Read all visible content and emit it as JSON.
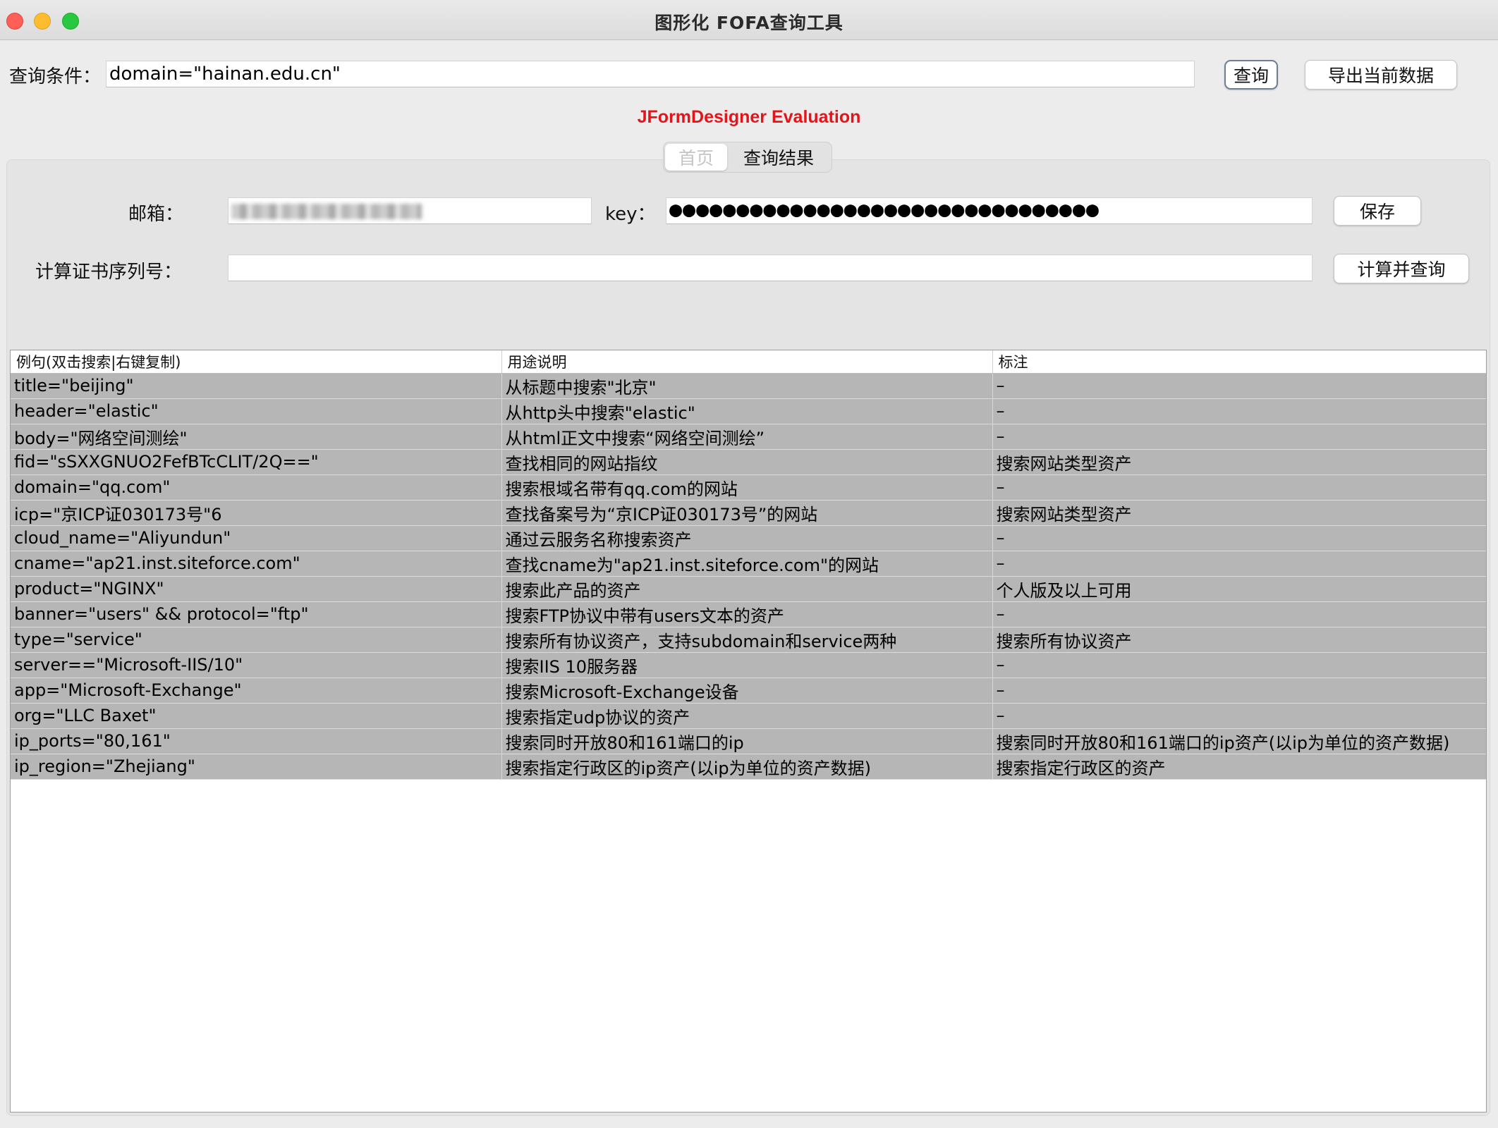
{
  "window": {
    "title": "图形化 FOFA查询工具"
  },
  "query": {
    "label": "查询条件：",
    "value": "domain=\"hainan.edu.cn\"",
    "query_button": "查询",
    "export_button": "导出当前数据"
  },
  "eval_banner": "JFormDesigner Evaluation",
  "tabs": {
    "home": "首页",
    "results": "查询结果"
  },
  "form": {
    "email_label": "邮箱：",
    "key_label": "key：",
    "key_value": "●●●●●●●●●●●●●●●●●●●●●●●●●●●●●●●●",
    "save_button": "保存",
    "serial_label": "计算证书序列号：",
    "serial_value": "",
    "calc_button": "计算并查询"
  },
  "table": {
    "headers": [
      "例句(双击搜索|右键复制)",
      "用途说明",
      "标注"
    ],
    "rows": [
      [
        "title=\"beijing\"",
        "从标题中搜索\"北京\"",
        "–"
      ],
      [
        "header=\"elastic\"",
        "从http头中搜索\"elastic\"",
        "–"
      ],
      [
        "body=\"网络空间测绘\"",
        "从html正文中搜索“网络空间测绘”",
        "–"
      ],
      [
        "fid=\"sSXXGNUO2FefBTcCLIT/2Q==\"",
        "查找相同的网站指纹",
        "搜索网站类型资产"
      ],
      [
        "domain=\"qq.com\"",
        "搜索根域名带有qq.com的网站",
        "–"
      ],
      [
        "icp=\"京ICP证030173号\"6",
        "查找备案号为“京ICP证030173号”的网站",
        "搜索网站类型资产"
      ],
      [
        "cloud_name=\"Aliyundun\"",
        "通过云服务名称搜索资产",
        "–"
      ],
      [
        "cname=\"ap21.inst.siteforce.com\"",
        "查找cname为\"ap21.inst.siteforce.com\"的网站",
        "–"
      ],
      [
        "product=\"NGINX\"",
        "搜索此产品的资产",
        "个人版及以上可用"
      ],
      [
        "banner=\"users\" && protocol=\"ftp\"",
        "搜索FTP协议中带有users文本的资产",
        "–"
      ],
      [
        "type=\"service\"",
        "搜索所有协议资产，支持subdomain和service两种",
        "搜索所有协议资产"
      ],
      [
        "server==\"Microsoft-IIS/10\"",
        "搜索IIS 10服务器",
        "–"
      ],
      [
        "app=\"Microsoft-Exchange\"",
        "搜索Microsoft-Exchange设备",
        "–"
      ],
      [
        "org=\"LLC Baxet\"",
        "搜索指定udp协议的资产",
        "–"
      ],
      [
        "ip_ports=\"80,161\"",
        "搜索同时开放80和161端口的ip",
        "搜索同时开放80和161端口的ip资产(以ip为单位的资产数据)"
      ],
      [
        "ip_region=\"Zhejiang\"",
        "搜索指定行政区的ip资产(以ip为单位的资产数据)",
        "搜索指定行政区的资产"
      ]
    ]
  }
}
